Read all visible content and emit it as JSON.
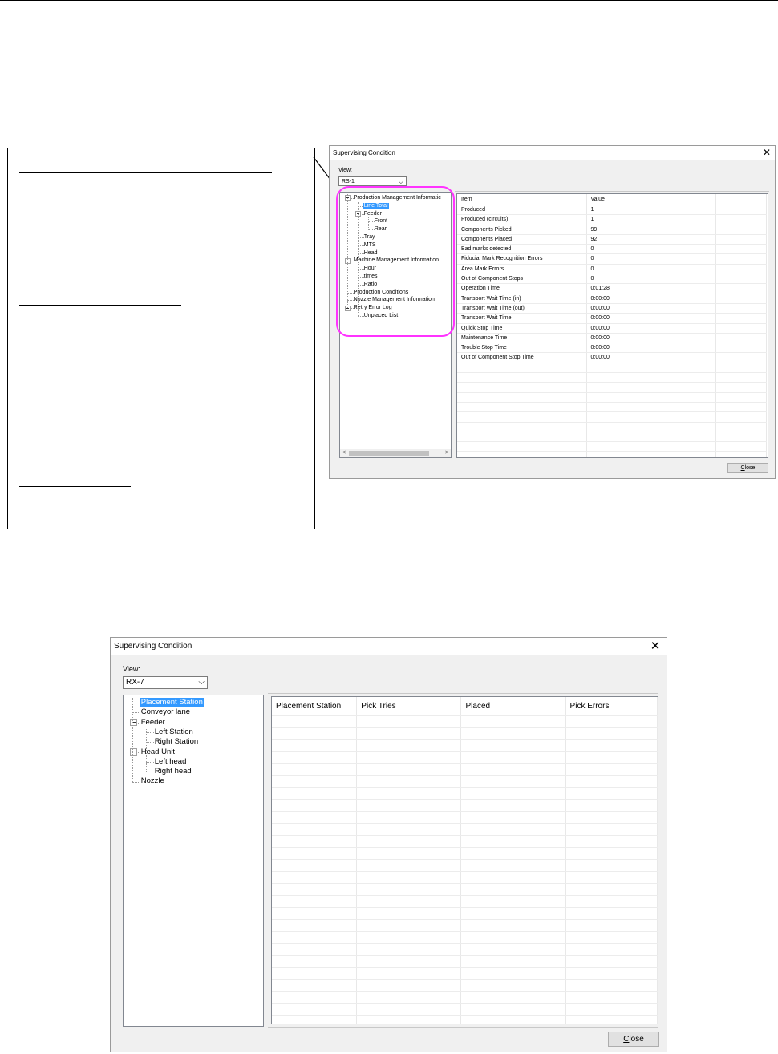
{
  "colors": {
    "highlight_circle": "#ff33ff",
    "selection": "#3399ff"
  },
  "window1": {
    "title": "Supervising Condition",
    "view_label": "View:",
    "view_value": "RS-1",
    "tree": {
      "items": [
        {
          "label": "Production Management Informatic",
          "expander": "collapse"
        },
        {
          "label": "Line Total",
          "selected": true
        },
        {
          "label": "Feeder",
          "expander": "collapse"
        },
        {
          "label": "Front"
        },
        {
          "label": "Rear"
        },
        {
          "label": "Tray"
        },
        {
          "label": "MTS"
        },
        {
          "label": "Head"
        },
        {
          "label": "Machine Management Information",
          "expander": "collapse"
        },
        {
          "label": "Hour"
        },
        {
          "label": "times"
        },
        {
          "label": "Ratio"
        },
        {
          "label": "Production Conditions"
        },
        {
          "label": "Nozzle Management Information"
        },
        {
          "label": "Retry Error Log",
          "expander": "collapse"
        },
        {
          "label": "Unplaced List"
        }
      ]
    },
    "table": {
      "headers": [
        "Item",
        "Value",
        ""
      ],
      "rows": [
        [
          "Produced",
          "1"
        ],
        [
          "Produced (circuits)",
          "1"
        ],
        [
          "Components Picked",
          "99"
        ],
        [
          "Components Placed",
          "92"
        ],
        [
          "Bad marks detected",
          "0"
        ],
        [
          "Fiducial Mark Recognition Errors",
          "0"
        ],
        [
          "Area Mark Errors",
          "0"
        ],
        [
          "Out of Component Stops",
          "0"
        ],
        [
          "Operation Time",
          "0:01:28"
        ],
        [
          "Transport Wait Time (in)",
          "0:00:00"
        ],
        [
          "Transport Wait Time (out)",
          "0:00:00"
        ],
        [
          "Transport Wait Time",
          "0:00:00"
        ],
        [
          "Quick Stop Time",
          "0:00:00"
        ],
        [
          "Maintenance Time",
          "0:00:00"
        ],
        [
          "Trouble Stop Time",
          "0:00:00"
        ],
        [
          "Out of Component Stop Time",
          "0:00:00"
        ]
      ]
    },
    "close_button": {
      "pre": "",
      "accel": "C",
      "post": "lose"
    }
  },
  "window2": {
    "title": "Supervising Condition",
    "view_label": "View:",
    "view_value": "RX-7",
    "tree": {
      "items": [
        {
          "label": "Placement Station",
          "selected": true
        },
        {
          "label": "Conveyor lane"
        },
        {
          "label": "Feeder",
          "expander": "collapse"
        },
        {
          "label": "Left Station"
        },
        {
          "label": "Right Station"
        },
        {
          "label": "Head Unit",
          "expander": "collapse"
        },
        {
          "label": "Left head"
        },
        {
          "label": "Right head"
        },
        {
          "label": "Nozzle"
        }
      ]
    },
    "table": {
      "headers": [
        "Placement Station",
        "Pick Tries",
        "Placed",
        "Pick Errors"
      ]
    },
    "close_button": {
      "pre": "",
      "accel": "C",
      "post": "lose"
    }
  }
}
